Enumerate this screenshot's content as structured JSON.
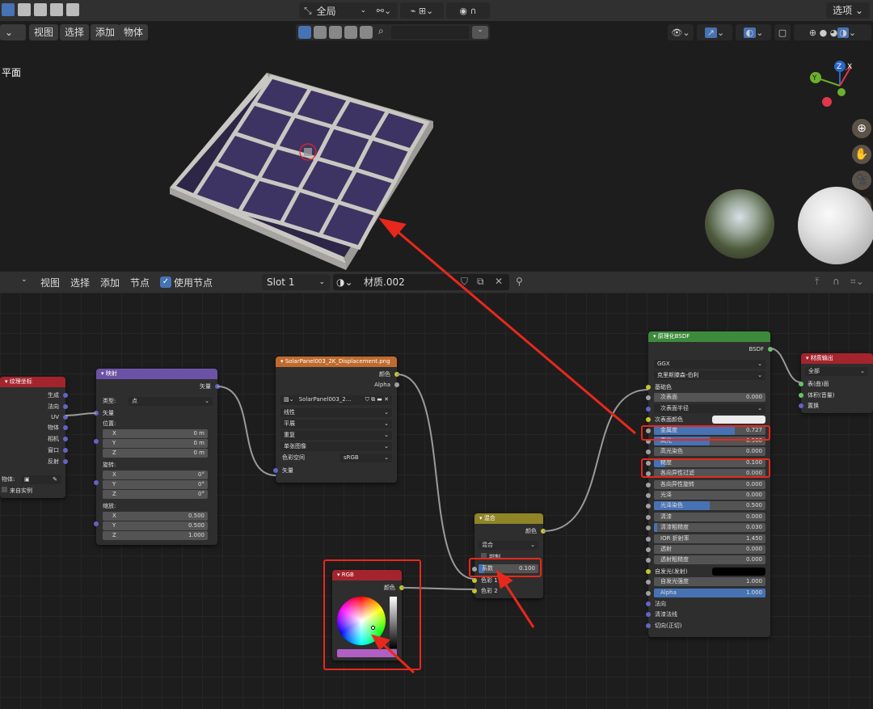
{
  "header": {
    "global_label": "全局",
    "options_label": "选项"
  },
  "viewport": {
    "menu": [
      "视图",
      "选择",
      "添加",
      "物体"
    ],
    "object_label": "平面",
    "gizmo_axes": {
      "x": "X",
      "y": "Y",
      "z": "Z"
    }
  },
  "node_editor": {
    "menu": [
      "视图",
      "选择",
      "添加",
      "节点"
    ],
    "use_nodes_label": "使用节点",
    "slot": "Slot 1",
    "material_name": "材质.002"
  },
  "nodes": {
    "texcoord": {
      "title": "纹理坐标",
      "outputs": [
        "生成",
        "法向",
        "UV",
        "物体",
        "相机",
        "窗口",
        "反射"
      ],
      "object_label": "物体:",
      "from_instancer": "来自实例"
    },
    "mapping": {
      "title": "映射",
      "output": "矢量",
      "type_label": "类型:",
      "type_value": "点",
      "vector_label": "矢量",
      "location_label": "位置:",
      "rotation_label": "旋转:",
      "scale_label": "缩放:",
      "location": [
        [
          "X",
          "0 m"
        ],
        [
          "Y",
          "0 m"
        ],
        [
          "Z",
          "0 m"
        ]
      ],
      "rotation": [
        [
          "X",
          "0°"
        ],
        [
          "Y",
          "0°"
        ],
        [
          "Z",
          "0°"
        ]
      ],
      "scale": [
        [
          "X",
          "0.500"
        ],
        [
          "Y",
          "0.500"
        ],
        [
          "Z",
          "1.000"
        ]
      ]
    },
    "image": {
      "title": "SolarPanel003_2K_Displacement.png",
      "outputs": [
        "颜色",
        "Alpha"
      ],
      "image_name": "SolarPanel003_2...",
      "interpolation": "线性",
      "projection": "平展",
      "extension": "重复",
      "source": "单张图像",
      "colorspace_label": "色彩空间",
      "colorspace_value": "sRGB",
      "vector_input": "矢量"
    },
    "mix": {
      "title": "混合",
      "output": "颜色",
      "blend_type": "混合",
      "clamp_label": "钳制",
      "factor_label": "系数",
      "factor_value": "0.100",
      "factor": 0.1,
      "color1": "色彩 1",
      "color2": "色彩 2"
    },
    "rgb": {
      "title": "RGB",
      "output": "颜色",
      "color": "#b15fc4"
    },
    "bsdf": {
      "title": "原理化BSDF",
      "output": "BSDF",
      "distribution": "GGX",
      "subsurface_method": "克里斯滕森-伯利",
      "rows": [
        {
          "label": "基础色",
          "type": "socket"
        },
        {
          "label": "次表面",
          "value": "0.000",
          "type": "field"
        },
        {
          "label": "次表面半径",
          "type": "dropdown"
        },
        {
          "label": "次表面颜色",
          "type": "swatch"
        },
        {
          "label": "金属度",
          "value": "0.727",
          "type": "bar",
          "fill": 0.727
        },
        {
          "label": "高光",
          "value": "0.500",
          "type": "bar",
          "fill": 0.5
        },
        {
          "label": "高光染色",
          "value": "0.000",
          "type": "field"
        },
        {
          "label": "糙度",
          "value": "0.100",
          "type": "bar",
          "fill": 0.1
        },
        {
          "label": "各向异性过滤",
          "value": "0.000",
          "type": "field"
        },
        {
          "label": "各向异性旋转",
          "value": "0.000",
          "type": "field"
        },
        {
          "label": "光泽",
          "value": "0.000",
          "type": "field"
        },
        {
          "label": "光泽染色",
          "value": "0.500",
          "type": "bar",
          "fill": 0.5
        },
        {
          "label": "清漆",
          "value": "0.000",
          "type": "field"
        },
        {
          "label": "清漆粗糙度",
          "value": "0.030",
          "type": "bar",
          "fill": 0.03
        },
        {
          "label": "IOR 折射率",
          "value": "1.450",
          "type": "field"
        },
        {
          "label": "透射",
          "value": "0.000",
          "type": "field"
        },
        {
          "label": "透射粗糙度",
          "value": "0.000",
          "type": "field"
        },
        {
          "label": "自发光(发射)",
          "type": "blackswatch"
        },
        {
          "label": "自发光强度",
          "value": "1.000",
          "type": "field"
        },
        {
          "label": "Alpha",
          "value": "1.000",
          "type": "bar",
          "fill": 1.0
        },
        {
          "label": "法向",
          "type": "socket"
        },
        {
          "label": "清漆法线",
          "type": "socket"
        },
        {
          "label": "切向(正切)",
          "type": "socket"
        }
      ]
    },
    "output": {
      "title": "材质输出",
      "target": "全部",
      "inputs": [
        "表(曲)面",
        "体积(音量)",
        "置换"
      ]
    }
  },
  "colors": {
    "accent": "#4772b3",
    "annotation_red": "#e8281c",
    "node_shader_header": "#3c8b3c",
    "node_texture_header": "#c06a2d",
    "node_vector_header": "#6b52a6",
    "node_input_header": "#a4242d",
    "node_color_header": "#8f8527"
  }
}
